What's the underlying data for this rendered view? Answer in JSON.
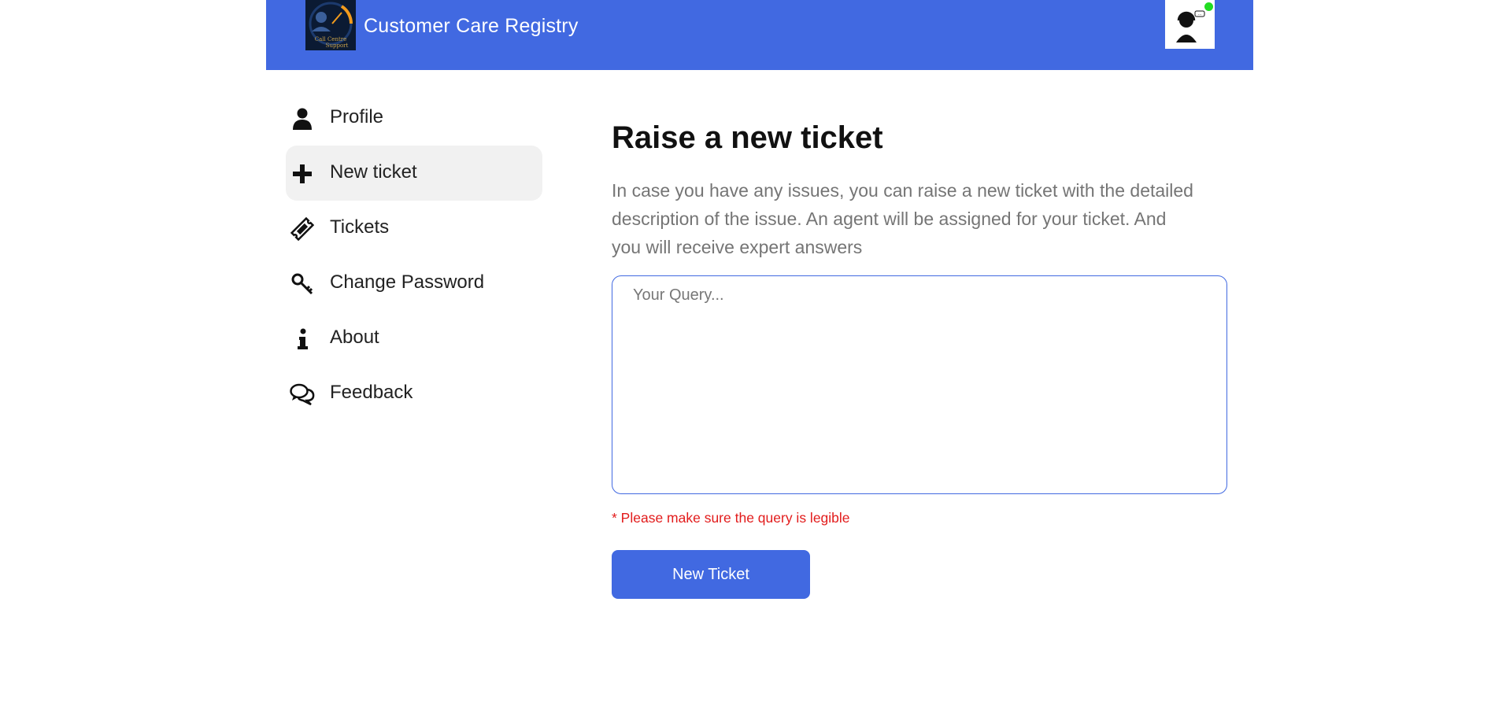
{
  "header": {
    "title": "Customer Care Registry",
    "logo_icon": "call-centre-support-logo",
    "avatar_icon": "support-agent-avatar",
    "online_color": "#22dd22",
    "brand_color": "#4169e1"
  },
  "sidebar": {
    "items": [
      {
        "label": "Profile",
        "icon": "user-icon",
        "active": false
      },
      {
        "label": "New ticket",
        "icon": "plus-icon",
        "active": true
      },
      {
        "label": "Tickets",
        "icon": "ticket-icon",
        "active": false
      },
      {
        "label": "Change Password",
        "icon": "key-icon",
        "active": false
      },
      {
        "label": "About",
        "icon": "info-icon",
        "active": false
      },
      {
        "label": "Feedback",
        "icon": "chat-bubbles-icon",
        "active": false
      }
    ]
  },
  "main": {
    "title": "Raise a new ticket",
    "description": "In case you have any issues, you can raise a new ticket with the detailed description of the issue. An agent will be assigned for your ticket. And you will receive expert answers",
    "query_placeholder": "Your Query...",
    "query_value": "",
    "hint": "* Please make sure the query is legible",
    "submit_label": "New Ticket",
    "hint_color": "#e21b1b"
  }
}
